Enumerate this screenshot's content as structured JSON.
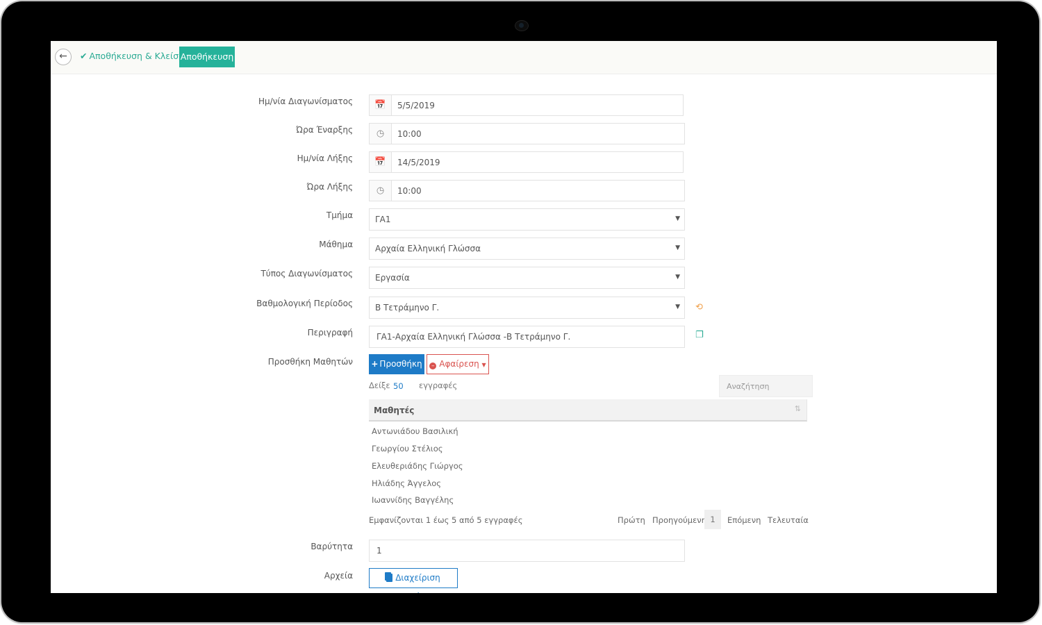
{
  "toolbar": {
    "back_icon": "arrow-left-icon",
    "save_close_label": "Αποθήκευση & Κλείσιμο",
    "save_label": "Αποθήκευση"
  },
  "form": {
    "exam_date": {
      "label": "Ημ/νία Διαγωνίσματος",
      "value": "5/5/2019"
    },
    "start_time": {
      "label": "Ώρα Έναρξης",
      "value": "10:00"
    },
    "end_date": {
      "label": "Ημ/νία Λήξης",
      "value": "14/5/2019"
    },
    "end_time": {
      "label": "Ώρα Λήξης",
      "value": "10:00"
    },
    "class": {
      "label": "Τμήμα",
      "value": "ΓΑ1"
    },
    "course": {
      "label": "Μάθημα",
      "value": "Αρχαία Ελληνική Γλώσσα"
    },
    "exam_type": {
      "label": "Τύπος Διαγωνίσματος",
      "value": "Εργασία"
    },
    "grading_period": {
      "label": "Βαθμολογική Περίοδος",
      "value": "Β Τετράμηνο Γ."
    },
    "description": {
      "label": "Περιγραφή",
      "value": "ΓΑ1-Αρχαία Ελληνική Γλώσσα -Β Τετράμηνο Γ."
    },
    "add_students": {
      "label": "Προσθήκη Μαθητών",
      "add_label": "Προσθήκη",
      "remove_label": "Αφαίρεση"
    },
    "weight": {
      "label": "Βαρύτητα",
      "value": "1"
    },
    "files": {
      "label": "Αρχεία",
      "button_label": "Διαχείριση Αρχείων"
    }
  },
  "table": {
    "show_label": "Δείξε",
    "page_size": "50",
    "records_label": "εγγραφές",
    "search_placeholder": "Αναζήτηση",
    "column": "Μαθητές",
    "rows": [
      "Αντωνιάδου Βασιλική",
      "Γεωργίου Στέλιος",
      "Ελευθεριάδης Γιώργος",
      "Ηλιάδης Άγγελος",
      "Ιωαννίδης Βαγγέλης"
    ],
    "info": "Εμφανίζονται 1 έως 5 από 5 εγγραφές",
    "pagination": {
      "first": "Πρώτη",
      "previous": "Προηγούμενη",
      "current": "1",
      "next": "Επόμενη",
      "last": "Τελευταία"
    }
  },
  "colors": {
    "accent": "#25b29a",
    "primary": "#1e7bc7",
    "danger": "#d9534f",
    "warning": "#f0a04b"
  }
}
